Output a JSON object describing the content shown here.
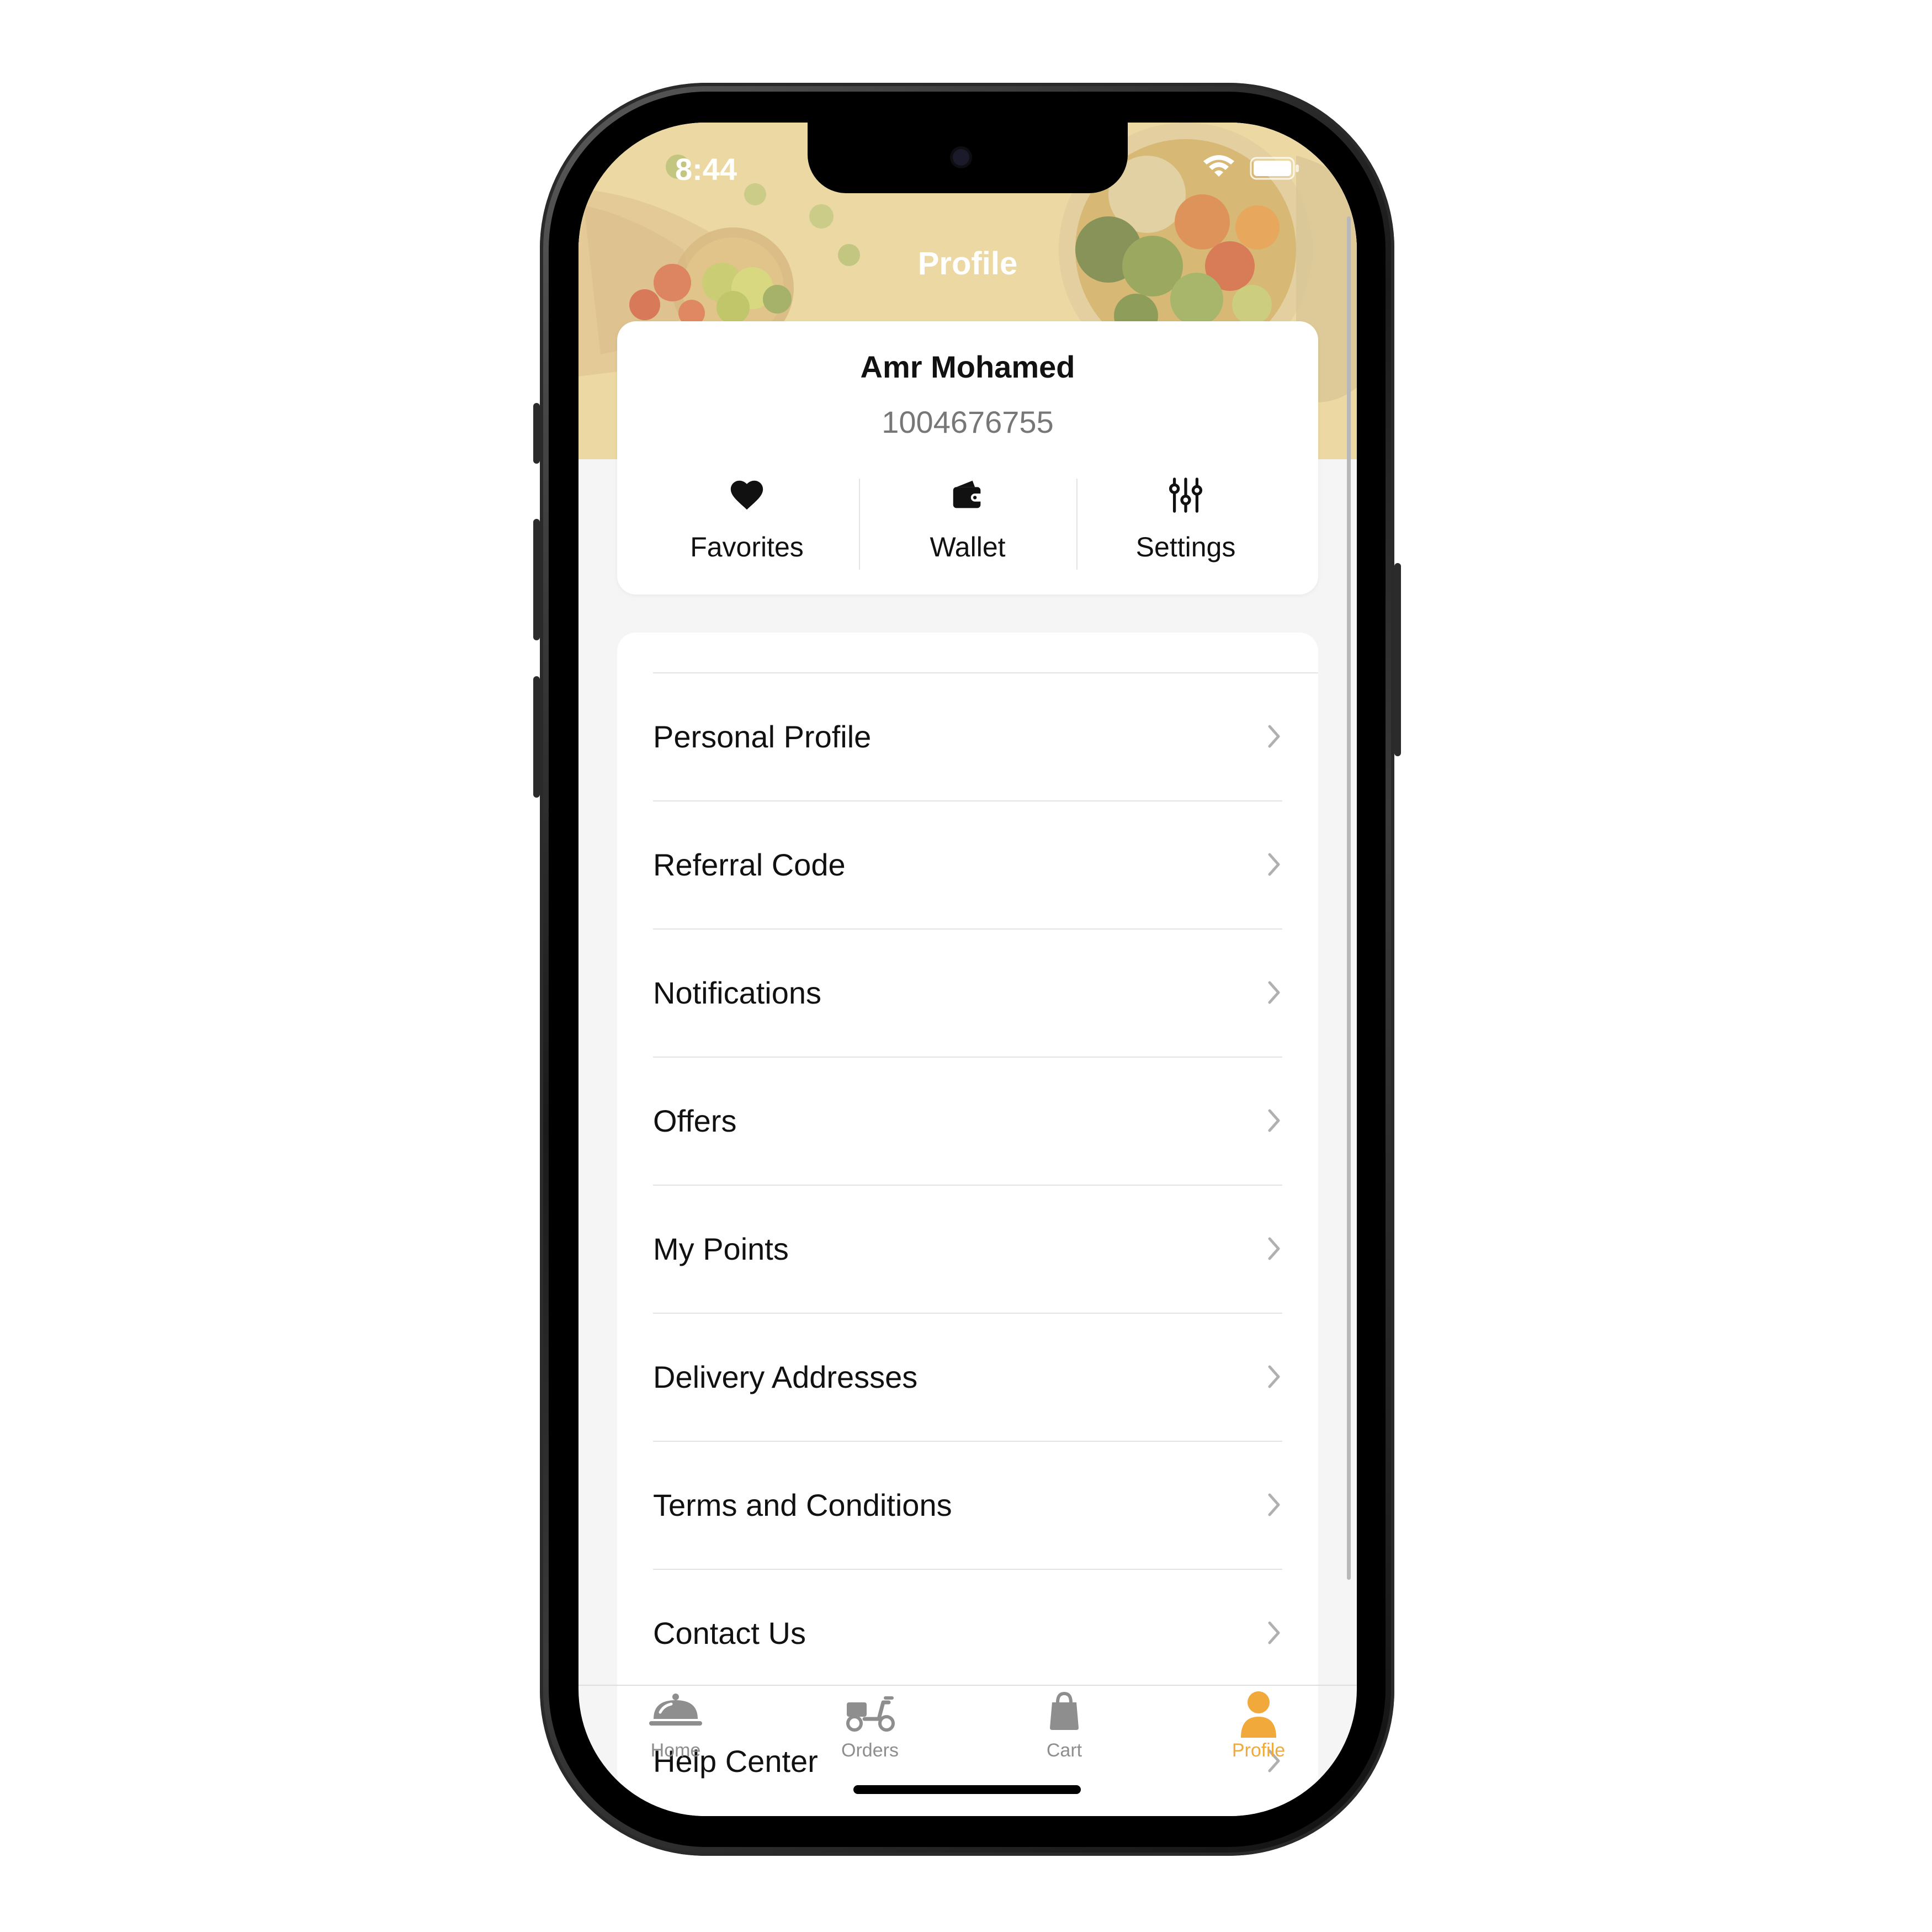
{
  "status_bar": {
    "time": "8:44"
  },
  "header": {
    "title": "Profile"
  },
  "profile": {
    "name": "Amr Mohamed",
    "phone": "1004676755"
  },
  "quick_actions": [
    {
      "label": "Favorites",
      "icon": "heart-icon"
    },
    {
      "label": "Wallet",
      "icon": "wallet-icon"
    },
    {
      "label": "Settings",
      "icon": "sliders-icon"
    }
  ],
  "menu": {
    "items": [
      {
        "label": "Personal Profile"
      },
      {
        "label": "Referral Code"
      },
      {
        "label": "Notifications"
      },
      {
        "label": "Offers"
      },
      {
        "label": "My Points"
      },
      {
        "label": "Delivery Addresses"
      },
      {
        "label": "Terms and Conditions"
      },
      {
        "label": "Contact Us"
      },
      {
        "label": "Help Center"
      }
    ]
  },
  "tabbar": {
    "tabs": [
      {
        "label": "Home",
        "icon": "cloche-icon",
        "active": false
      },
      {
        "label": "Orders",
        "icon": "scooter-icon",
        "active": false
      },
      {
        "label": "Cart",
        "icon": "shopping-bag-icon",
        "active": false
      },
      {
        "label": "Profile",
        "icon": "person-icon",
        "active": true
      }
    ],
    "active_color": "#f0a93a",
    "inactive_color": "#8e8e8e"
  },
  "colors": {
    "accent": "#f0a93a",
    "background": "#f5f5f5",
    "card": "#ffffff"
  }
}
